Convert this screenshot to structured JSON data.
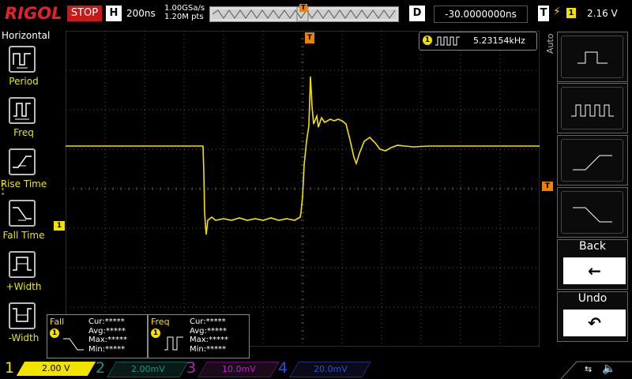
{
  "header": {
    "brand": "RIGOL",
    "run_state": "STOP",
    "horizontal_label": "H",
    "timebase": "200ns",
    "sample_rate": "1.00GSa/s",
    "memory_depth": "1.20M pts",
    "trigger_position_marker": "T",
    "delay_label": "D",
    "delay_value": "-30.0000000ns",
    "trigger_label": "T",
    "trigger_source": "1",
    "trigger_level": "2.16 V"
  },
  "left_menu": {
    "title": "Horizontal",
    "items": [
      {
        "label": "Period",
        "icon": "period-icon"
      },
      {
        "label": "Freq",
        "icon": "frequency-icon"
      },
      {
        "label": "Rise Time",
        "icon": "rise-time-icon"
      },
      {
        "label": "Fall Time",
        "icon": "fall-time-icon"
      },
      {
        "label": "+Width",
        "icon": "positive-width-icon"
      },
      {
        "label": "-Width",
        "icon": "negative-width-icon"
      }
    ]
  },
  "display": {
    "trigger_marker": "T",
    "trigger_level_marker": "T",
    "ch1_ground_marker": "1",
    "frequency_counter": {
      "channel": "1",
      "value": "5.23154kHz"
    },
    "trace_color": "#f2e200",
    "grid_color": "#555555"
  },
  "right_menu": {
    "mode_label": "Auto",
    "buttons": [
      {
        "name": "rbtn-1",
        "icon": "single-pulse-icon"
      },
      {
        "name": "rbtn-2",
        "icon": "pulse-train-icon"
      },
      {
        "name": "rbtn-3",
        "icon": "rising-edge-icon"
      },
      {
        "name": "rbtn-4",
        "icon": "falling-edge-icon"
      }
    ],
    "back_label": "Back",
    "back_icon": "←",
    "undo_label": "Undo",
    "undo_icon": "↶"
  },
  "measurements": [
    {
      "name": "Fall",
      "channel": "1",
      "cur": "Cur:*****",
      "avg": "Avg:*****",
      "max": "Max:*****",
      "min": "Min:*****"
    },
    {
      "name": "Freq",
      "channel": "1",
      "cur": "Cur:*****",
      "avg": "Avg:*****",
      "max": "Max:*****",
      "min": "Min:*****"
    }
  ],
  "channels": [
    {
      "num": "1",
      "scale": "2.00 V",
      "color": "#f2e200",
      "active": true
    },
    {
      "num": "2",
      "scale": "2.00mV",
      "color": "#0a9a8a",
      "active": false
    },
    {
      "num": "3",
      "scale": "10.0mV",
      "color": "#c020c0",
      "active": false
    },
    {
      "num": "4",
      "scale": "20.0mV",
      "color": "#3050d0",
      "active": false
    }
  ],
  "status": {
    "usb_icon": "usb-icon",
    "speaker_icon": "speaker-muted-icon"
  }
}
